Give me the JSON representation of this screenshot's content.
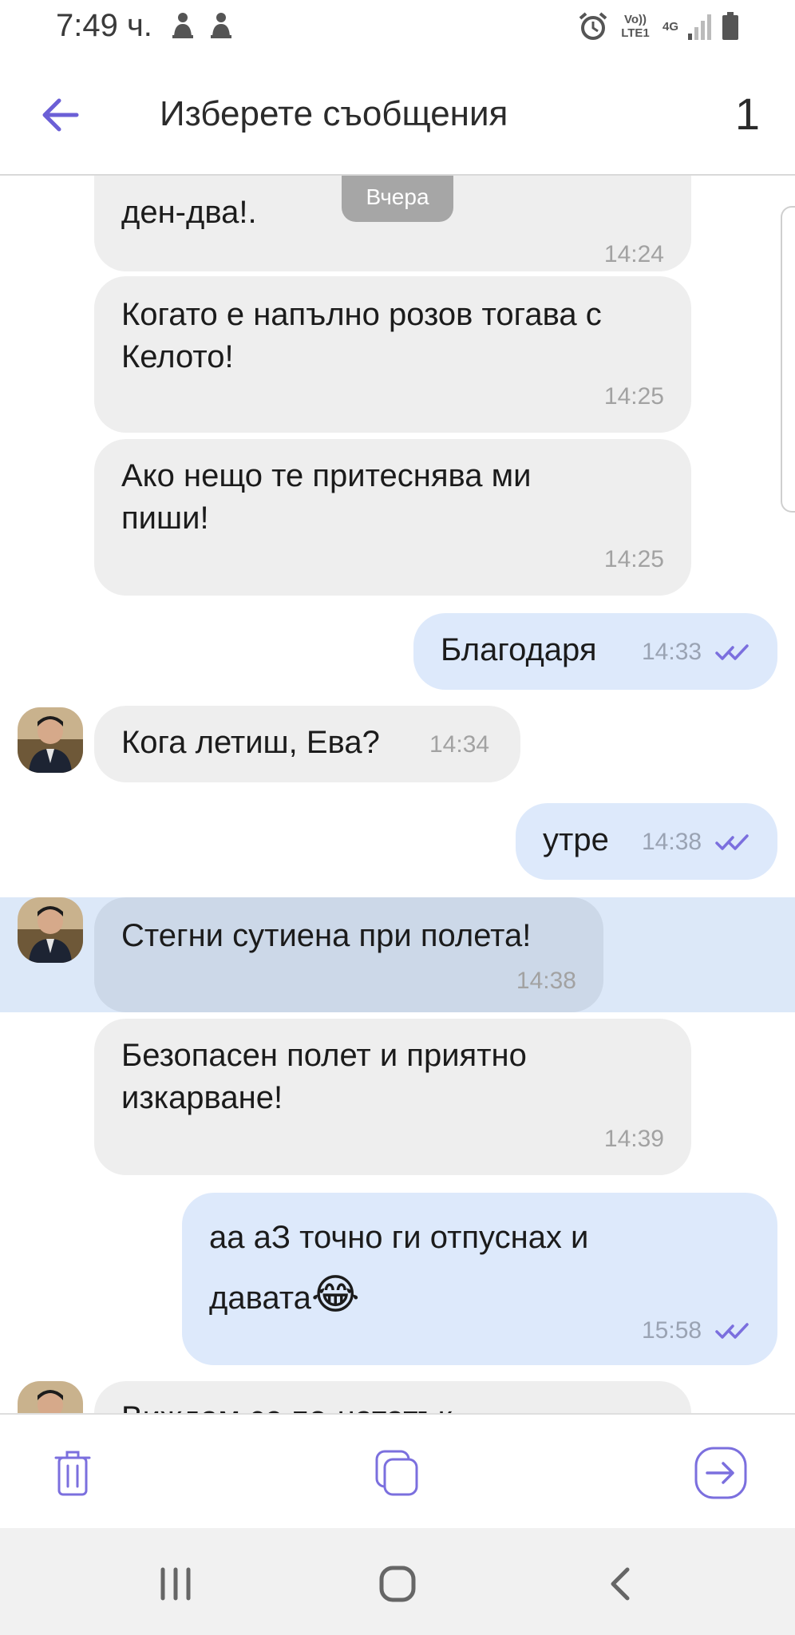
{
  "status_bar": {
    "time": "7:49 ч.",
    "volte_label": "Vo)) LTE1",
    "net_label": "4G"
  },
  "header": {
    "title": "Изберете съобщения",
    "selected_count": "1"
  },
  "chat": {
    "date_chip": "Вчера",
    "messages": [
      {
        "direction": "in",
        "text": "ден-два!.",
        "time": "14:24"
      },
      {
        "direction": "in",
        "text": "Когато е напълно розов тогава с Келото!",
        "time": "14:25"
      },
      {
        "direction": "in",
        "text": "Ако нещо те притеснява ми пиши!",
        "time": "14:25"
      },
      {
        "direction": "out",
        "text": "Благодаря",
        "time": "14:33"
      },
      {
        "direction": "in",
        "text": "Кога летиш, Ева?",
        "time": "14:34"
      },
      {
        "direction": "out",
        "text": "утре",
        "time": "14:38"
      },
      {
        "direction": "in",
        "text": "Стегни сутиена при полета!",
        "time": "14:38",
        "selected": true
      },
      {
        "direction": "in",
        "text": "Безопасен полет и приятно изкарване!",
        "time": "14:39"
      },
      {
        "direction": "out",
        "text": "аа аЗ точно ги отпуснах и давата",
        "emoji": "😂",
        "time": "15:58"
      },
      {
        "direction": "in",
        "text": "Виждам се по-нататък...",
        "time": ""
      }
    ]
  },
  "actions": {
    "delete_icon": "trash-icon",
    "copy_icon": "copy-icon",
    "forward_icon": "forward-icon"
  },
  "colors": {
    "accent": "#6b5fd6",
    "incoming_bubble": "#eeeeee",
    "outgoing_bubble": "#dde9fb",
    "selected_row": "#dce8f8"
  }
}
